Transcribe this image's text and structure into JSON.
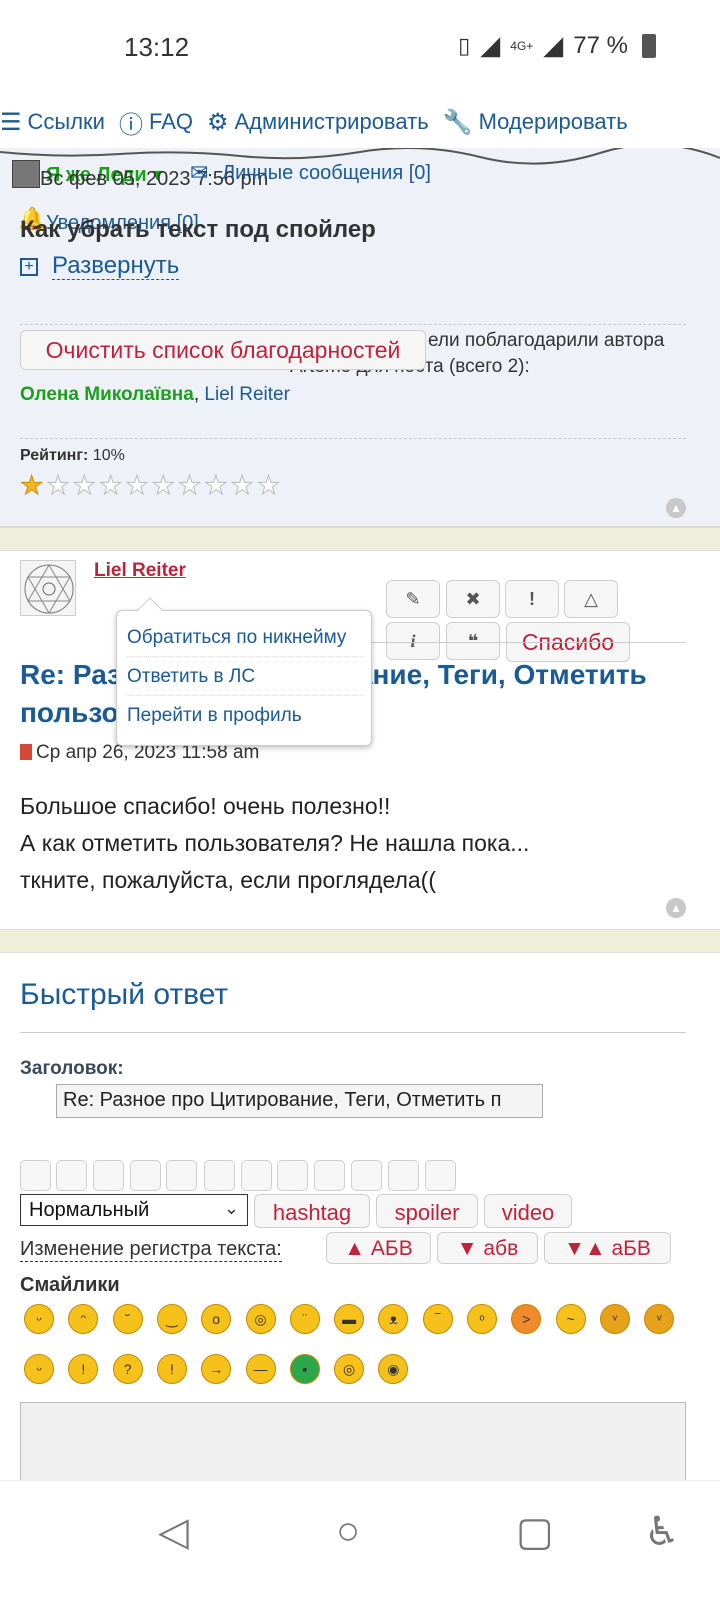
{
  "status": {
    "time": "13:12",
    "network": "4G+",
    "battery": "77 %"
  },
  "nav": {
    "links": "Ссылки",
    "faq": "FAQ",
    "admin": "Администрировать",
    "moderate": "Модерировать"
  },
  "overlap": {
    "user": "Я же Леди ▾",
    "messages": "Личные сообщения [0]",
    "notifications": "Уведомления [0]",
    "date": "Вс фев 05, 2023 7:56 pm"
  },
  "post1": {
    "title": "Как убрать текст под спойлер",
    "expand": "Развернуть",
    "clear_thanks": "Очистить список благодарностей",
    "thanks_text_1": "ели поблагодарили автора",
    "thanks_text_2": "Artemo для поста (всего 2):",
    "thanker_1": "Олена Миколаївна",
    "thanker_sep": ", ",
    "thanker_2": "Liel Reiter",
    "rating_label": "Рейтинг:",
    "rating_value": "10%",
    "rating_fraction": 0.1
  },
  "post2": {
    "author": "Liel Reiter",
    "thanks_btn": "Спасибо",
    "btn_edit": "✎",
    "btn_delete": "✖",
    "btn_report": "!",
    "btn_warn": "△",
    "btn_info": "i",
    "btn_quote": "❝",
    "title": "Re: Разное про Цитирование, Теги, Отметить пользователя",
    "date": "Ср апр 26, 2023 11:58 am",
    "body_1": "Большое спасибо! очень полезно!!",
    "body_2": "А как отметить пользователя? Не нашла пока...",
    "body_3": "ткните, пожалуйста, если проглядела(("
  },
  "popup": {
    "item_1": "Обратиться по никнейму",
    "item_2": "Ответить в ЛС",
    "item_3": "Перейти в профиль"
  },
  "quick_reply": {
    "title": "Быстрый ответ",
    "subject_label": "Заголовок:",
    "subject_value": "Re: Разное про Цитирование, Теги, Отметить п",
    "font_size": "Нормальный",
    "tag_hashtag": "hashtag",
    "tag_spoiler": "spoiler",
    "tag_video": "video",
    "case_label": "Изменение регистра текста:",
    "case_upper": "▲ АБВ",
    "case_lower": "▼ абв",
    "case_mixed": "▼▲ аБВ",
    "smilies_label": "Смайлики"
  },
  "colors": {
    "accent": "#1a5a96",
    "alert": "#c0223b",
    "green": "#1aa11a"
  }
}
